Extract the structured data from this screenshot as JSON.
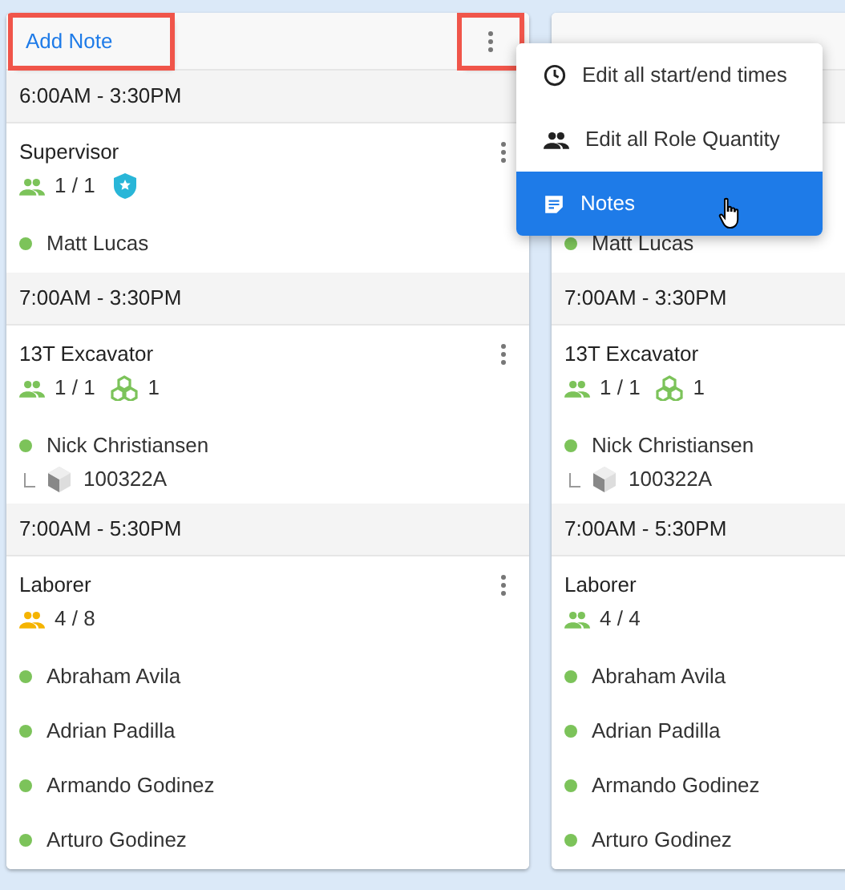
{
  "columns": [
    {
      "add_note": {
        "label": "Add Note",
        "highlighted": true
      },
      "menu_button": {
        "highlighted": true
      },
      "groups": [
        {
          "time": "6:00AM - 3:30PM",
          "roles": [
            {
              "name": "Supervisor",
              "quantity": "1 / 1",
              "color": "#7cc35a",
              "badge": true,
              "assignees": [
                {
                  "name": "Matt Lucas",
                  "color": "#7cc35a"
                }
              ]
            }
          ]
        },
        {
          "time": "7:00AM - 3:30PM",
          "roles": [
            {
              "name": "13T Excavator",
              "quantity": "1 / 1",
              "color": "#7cc35a",
              "equipment_count": "1",
              "assignees": [
                {
                  "name": "Nick Christiansen",
                  "color": "#7cc35a",
                  "equipment": "100322A"
                }
              ]
            }
          ]
        },
        {
          "time": "7:00AM - 5:30PM",
          "roles": [
            {
              "name": "Laborer",
              "quantity": "4 / 8",
              "color": "#f5b400",
              "assignees": [
                {
                  "name": "Abraham Avila",
                  "color": "#7cc35a"
                },
                {
                  "name": "Adrian Padilla",
                  "color": "#7cc35a"
                },
                {
                  "name": "Armando Godinez",
                  "color": "#7cc35a"
                },
                {
                  "name": "Arturo Godinez",
                  "color": "#7cc35a"
                }
              ]
            }
          ]
        }
      ]
    },
    {
      "groups": [
        {
          "roles": [
            {
              "assignees": [
                {
                  "name": "Matt Lucas",
                  "color": "#7cc35a"
                }
              ]
            }
          ]
        },
        {
          "time": "7:00AM - 3:30PM",
          "roles": [
            {
              "name": "13T Excavator",
              "quantity": "1 / 1",
              "color": "#7cc35a",
              "equipment_count": "1",
              "assignees": [
                {
                  "name": "Nick Christiansen",
                  "color": "#7cc35a",
                  "equipment": "100322A"
                }
              ]
            }
          ]
        },
        {
          "time": "7:00AM - 5:30PM",
          "roles": [
            {
              "name": "Laborer",
              "quantity": "4 / 4",
              "color": "#7cc35a",
              "assignees": [
                {
                  "name": "Abraham Avila",
                  "color": "#7cc35a"
                },
                {
                  "name": "Adrian Padilla",
                  "color": "#7cc35a"
                },
                {
                  "name": "Armando Godinez",
                  "color": "#7cc35a"
                },
                {
                  "name": "Arturo Godinez",
                  "color": "#7cc35a"
                }
              ]
            }
          ]
        }
      ]
    }
  ],
  "menu": {
    "items": [
      {
        "label": "Edit all start/end times",
        "kind": "time",
        "selected": false
      },
      {
        "label": "Edit all Role Quantity",
        "kind": "quantity",
        "selected": false
      },
      {
        "label": "Notes",
        "kind": "notes",
        "selected": true
      }
    ]
  }
}
